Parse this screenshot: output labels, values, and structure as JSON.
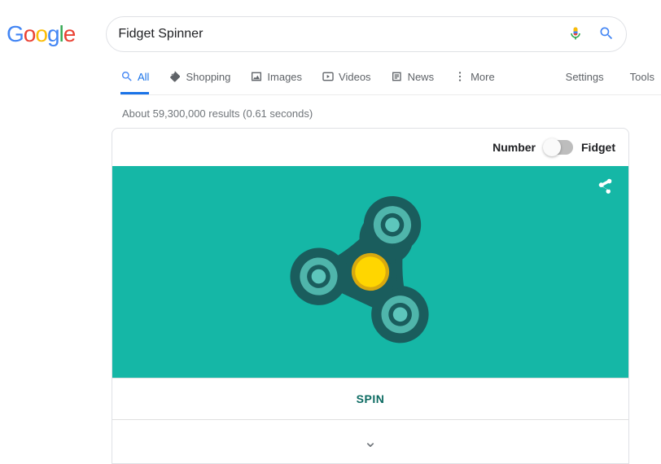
{
  "search": {
    "value": "Fidget Spinner"
  },
  "tabs": {
    "all": "All",
    "shopping": "Shopping",
    "images": "Images",
    "videos": "Videos",
    "news": "News",
    "more": "More",
    "settings": "Settings",
    "tools": "Tools"
  },
  "results_info": "About 59,300,000 results (0.61 seconds)",
  "card": {
    "toggle_left": "Number",
    "toggle_right": "Fidget",
    "spin_label": "SPIN"
  }
}
